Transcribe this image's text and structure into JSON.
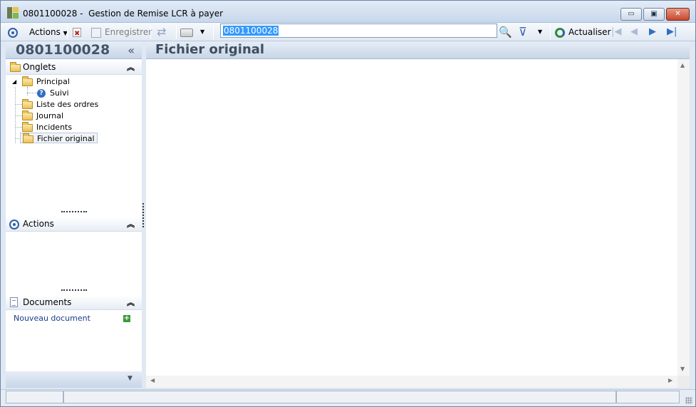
{
  "window": {
    "title": "0801100028 -  Gestion de Remise LCR à payer",
    "minimize_label": "▭",
    "maximize_label": "▣",
    "close_label": "✕"
  },
  "toolbar": {
    "actions_label": "Actions",
    "save_label": "Enregistrer",
    "search_value": "0801100028",
    "refresh_label": "Actualiser"
  },
  "left_panel": {
    "record_title": "0801100028",
    "collapse_label": "«",
    "tabs_section": {
      "label": "Onglets",
      "items": [
        {
          "label": "Principal"
        },
        {
          "label": "Suivi"
        },
        {
          "label": "Liste des ordres"
        },
        {
          "label": "Journal"
        },
        {
          "label": "Incidents"
        },
        {
          "label": "Fichier original"
        }
      ]
    },
    "actions_section": {
      "label": "Actions"
    },
    "documents_section": {
      "label": "Documents",
      "new_document_label": "Nouveau document"
    }
  },
  "main": {
    "page_title": "Fichier original"
  },
  "colors": {
    "accent": "#2f5fa8",
    "selection": "#3399ff",
    "link": "#1a3c8c"
  }
}
